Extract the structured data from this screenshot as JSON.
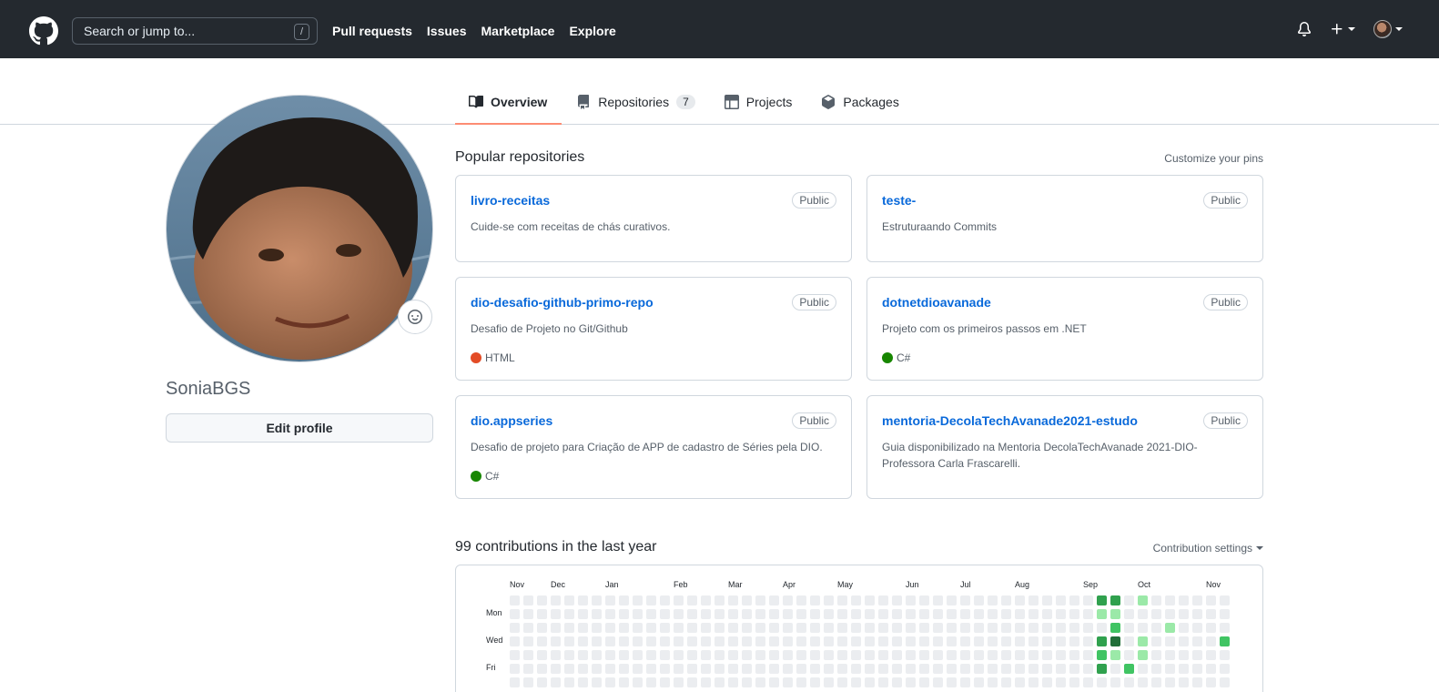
{
  "header": {
    "search_placeholder": "Search or jump to...",
    "slash_key": "/",
    "nav": [
      "Pull requests",
      "Issues",
      "Marketplace",
      "Explore"
    ]
  },
  "tabs": [
    {
      "label": "Overview",
      "icon": "book-icon",
      "selected": true
    },
    {
      "label": "Repositories",
      "icon": "repo-icon",
      "count": "7"
    },
    {
      "label": "Projects",
      "icon": "table-icon"
    },
    {
      "label": "Packages",
      "icon": "package-icon"
    }
  ],
  "profile": {
    "username": "SoniaBGS",
    "edit_label": "Edit profile"
  },
  "popular": {
    "title": "Popular repositories",
    "customize": "Customize your pins",
    "repos": [
      {
        "name": "livro-receitas",
        "badge": "Public",
        "desc": "Cuide-se com receitas de chás curativos.",
        "lang": "",
        "lang_color": ""
      },
      {
        "name": "teste-",
        "badge": "Public",
        "desc": "Estruturaando Commits",
        "lang": "",
        "lang_color": ""
      },
      {
        "name": "dio-desafio-github-primo-repo",
        "badge": "Public",
        "desc": "Desafio de Projeto no Git/Github",
        "lang": "HTML",
        "lang_color": "#e34c26"
      },
      {
        "name": "dotnetdioavanade",
        "badge": "Public",
        "desc": "Projeto com os primeiros passos em .NET",
        "lang": "C#",
        "lang_color": "#178600"
      },
      {
        "name": "dio.appseries",
        "badge": "Public",
        "desc": "Desafio de projeto para Criação de APP de cadastro de Séries pela DIO.",
        "lang": "C#",
        "lang_color": "#178600"
      },
      {
        "name": "mentoria-DecolaTechAvanade2021-estudo",
        "badge": "Public",
        "desc": "Guia disponibilizado na Mentoria DecolaTechAvanade 2021-DIO-Professora Carla Frascarelli.",
        "lang": "",
        "lang_color": ""
      }
    ]
  },
  "contributions": {
    "title": "99 contributions in the last year",
    "settings": "Contribution settings",
    "months": [
      "Nov",
      "Dec",
      "Jan",
      "Feb",
      "Mar",
      "Apr",
      "May",
      "Jun",
      "Jul",
      "Aug",
      "Sep",
      "Oct",
      "Nov"
    ],
    "month_weeks": [
      0,
      3,
      7,
      12,
      16,
      20,
      24,
      29,
      33,
      37,
      42,
      46,
      51
    ],
    "days": [
      "Mon",
      "Wed",
      "Fri"
    ],
    "day_rows": [
      1,
      3,
      5
    ],
    "weeks": 53,
    "colors": [
      "#ebedf0",
      "#9be9a8",
      "#40c463",
      "#30a14e",
      "#216e39"
    ],
    "active": [
      [
        43,
        0,
        3
      ],
      [
        44,
        0,
        3
      ],
      [
        46,
        0,
        1
      ],
      [
        43,
        1,
        1
      ],
      [
        44,
        1,
        1
      ],
      [
        44,
        2,
        2
      ],
      [
        48,
        2,
        1
      ],
      [
        43,
        3,
        3
      ],
      [
        44,
        3,
        4
      ],
      [
        46,
        3,
        1
      ],
      [
        52,
        3,
        2
      ],
      [
        43,
        4,
        2
      ],
      [
        44,
        4,
        1
      ],
      [
        46,
        4,
        1
      ],
      [
        43,
        5,
        3
      ],
      [
        45,
        5,
        2
      ]
    ]
  }
}
